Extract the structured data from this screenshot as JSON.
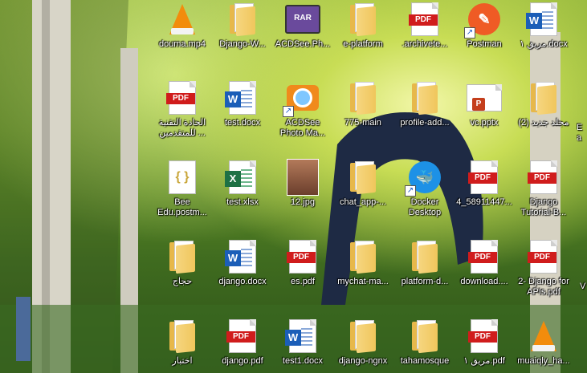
{
  "desktop": {
    "icons": [
      {
        "label": "douma.mp4",
        "icon": "vlc-icon"
      },
      {
        "label": "Django-W...",
        "icon": "folder-icon"
      },
      {
        "label": "ACDSee.Ph...",
        "icon": "rar-icon"
      },
      {
        "label": "e-platform",
        "icon": "folder-icon"
      },
      {
        "label": ".archivete...",
        "icon": "pdf-icon"
      },
      {
        "label": "Postman",
        "icon": "postman-icon"
      },
      {
        "label": "مريق ١.docx",
        "icon": "word-icon"
      },
      {
        "label": "الحادة التقنية للمتقدمين ...",
        "icon": "pdf-icon"
      },
      {
        "label": "test.docx",
        "icon": "word-icon"
      },
      {
        "label": "ACDSee Photo Ma...",
        "icon": "acdsee-icon"
      },
      {
        "label": "775-main",
        "icon": "folder-icon"
      },
      {
        "label": "profile-add...",
        "icon": "folder-icon"
      },
      {
        "label": "vc.pptx",
        "icon": "powerpoint-icon"
      },
      {
        "label": "(2) مجلد جديد",
        "icon": "folder-icon"
      },
      {
        "label": "Bee Edu.postm...",
        "icon": "json-icon"
      },
      {
        "label": "test.xlsx",
        "icon": "excel-icon"
      },
      {
        "label": "12.jpg",
        "icon": "photo-icon"
      },
      {
        "label": "chat_app-...",
        "icon": "folder-icon"
      },
      {
        "label": "Docker Desktop",
        "icon": "docker-icon"
      },
      {
        "label": "4_58911447...",
        "icon": "pdf-icon"
      },
      {
        "label": "Django Tutorial-B...",
        "icon": "pdf-icon"
      },
      {
        "label": "حجاج",
        "icon": "folder-icon"
      },
      {
        "label": "django.docx",
        "icon": "word-icon"
      },
      {
        "label": "es.pdf",
        "icon": "pdf-icon"
      },
      {
        "label": "mychat-ma...",
        "icon": "folder-icon"
      },
      {
        "label": "platform-d...",
        "icon": "folder-icon"
      },
      {
        "label": "download....",
        "icon": "pdf-icon"
      },
      {
        "label": "2- Django for APIs.pdf",
        "icon": "pdf-icon"
      },
      {
        "label": "اختبار",
        "icon": "folder-icon"
      },
      {
        "label": "django.pdf",
        "icon": "pdf-icon"
      },
      {
        "label": "test1.docx",
        "icon": "word-icon"
      },
      {
        "label": "django-ngnx",
        "icon": "folder-icon"
      },
      {
        "label": "tahamosque",
        "icon": "folder-icon"
      },
      {
        "label": "مريق ١.pdf",
        "icon": "pdf-icon"
      },
      {
        "label": "muaiqly_ha...",
        "icon": "vlc-icon"
      }
    ],
    "edge_labels": [
      "Ea",
      "V"
    ]
  },
  "colors": {
    "pdf": "#d01c1c",
    "word": "#1b5eb8",
    "excel": "#1e7145",
    "folder": "#f0c65c",
    "postman": "#ef5b25",
    "docker": "#1d91e6"
  }
}
